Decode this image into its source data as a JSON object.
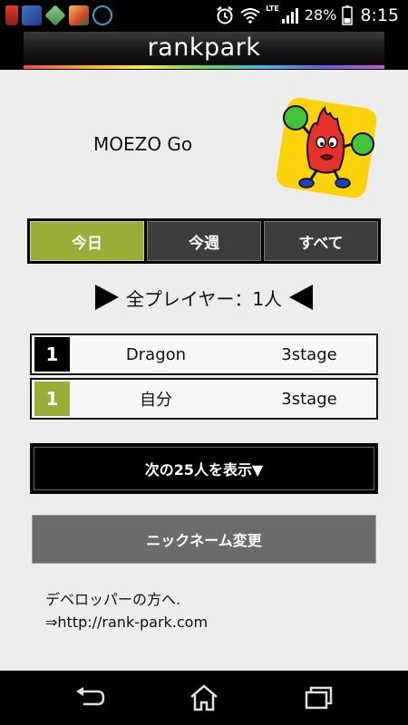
{
  "status_bar": {
    "network": "LTE",
    "battery_percent": "28%",
    "time": "8:15",
    "icons": [
      "battery-saver-icon",
      "app-notification-icon",
      "gem-app-icon",
      "game-app-icon",
      "browser-app-icon",
      "alarm-icon",
      "wifi-icon",
      "signal-icon",
      "battery-icon"
    ]
  },
  "header": {
    "title": "rankpark"
  },
  "profile": {
    "name": "MOEZO Go",
    "avatar_icon": "flame-character-icon"
  },
  "tabs": [
    {
      "label": "今日",
      "active": true
    },
    {
      "label": "今週",
      "active": false
    },
    {
      "label": "すべて",
      "active": false
    }
  ],
  "player_count": "全プレイヤー：1人",
  "ranking": [
    {
      "rank": "1",
      "name": "Dragon",
      "stage": "3stage"
    },
    {
      "rank": "1",
      "name": "自分",
      "stage": "3stage"
    }
  ],
  "next_button": "次の25人を表示▼",
  "nickname_button": "ニックネーム変更",
  "developer": {
    "line1": "デベロッパーの方へ.",
    "link": "⇒http://rank-park.com"
  },
  "colors": {
    "accent_green": "#98ae37",
    "dark": "#000000",
    "tab_inactive": "#3d3d3d",
    "button_gray": "#6b6b6b"
  },
  "nav": [
    "back-icon",
    "home-icon",
    "recent-apps-icon"
  ]
}
